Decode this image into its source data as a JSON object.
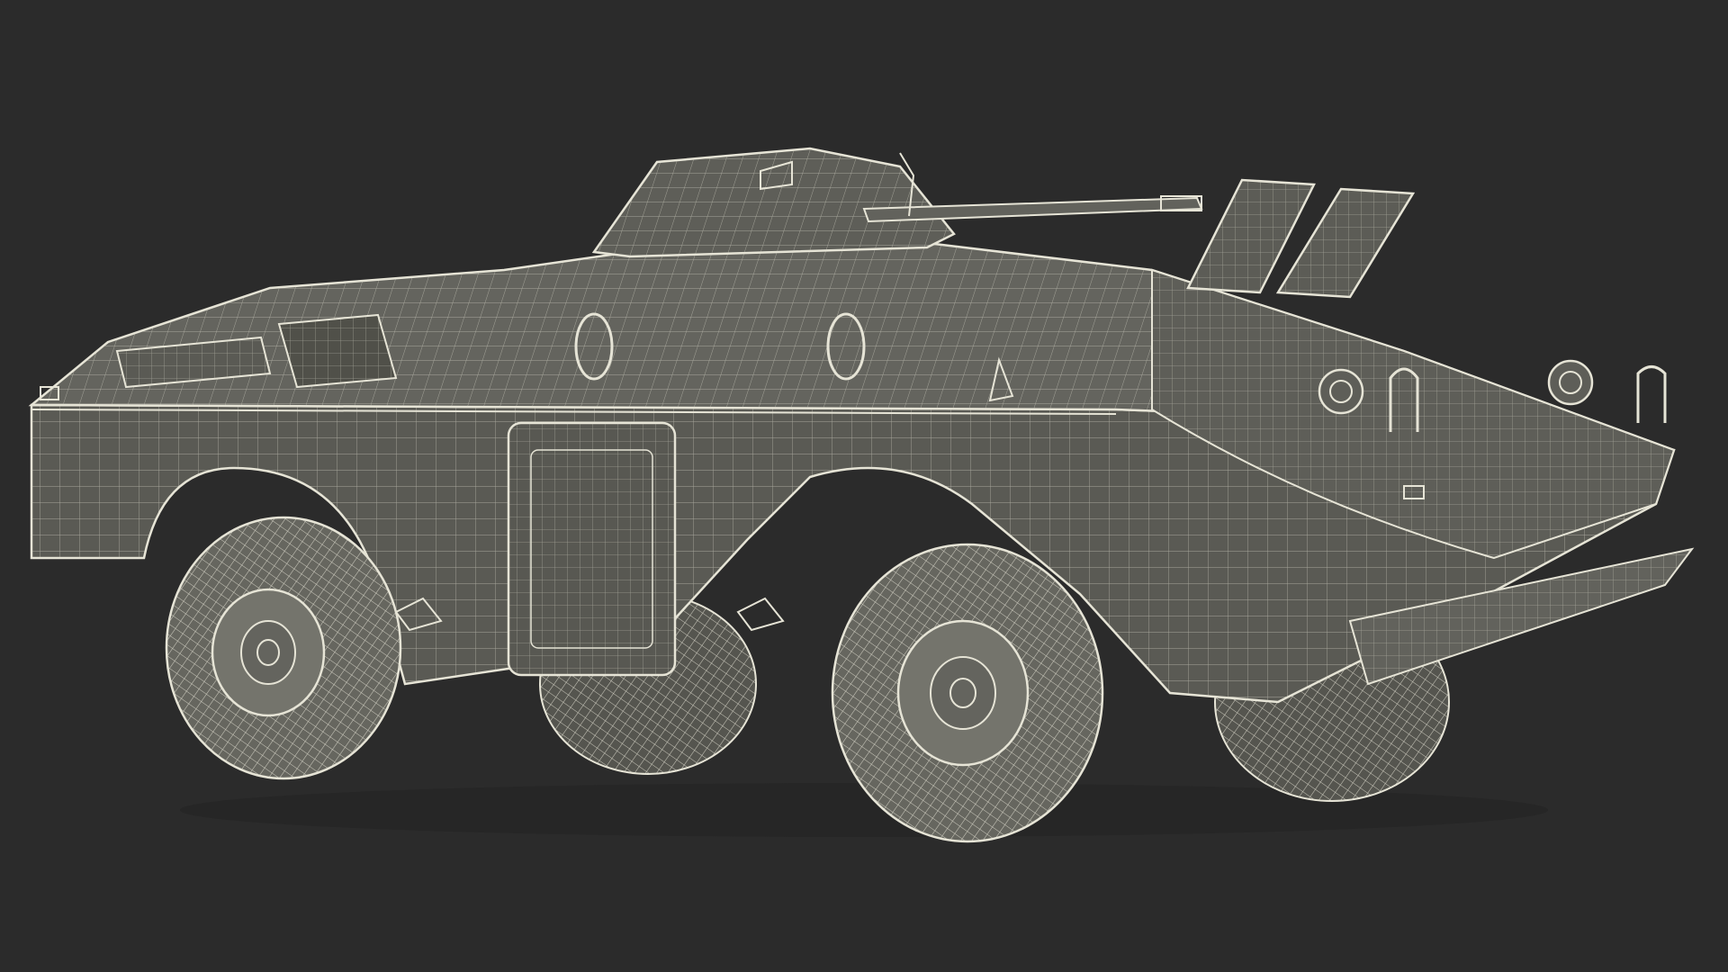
{
  "scene": {
    "subject_icon": "armored-vehicle-wireframe-icon",
    "colors": {
      "background": "#2b2b2b",
      "wire": "#e6e4d6",
      "wire_dim": "#9c9a8e",
      "body_fill": "#5c5c56",
      "body_fill_dark": "#474743",
      "tire_fill": "#6a6a64",
      "hub_fill": "#7a7a72"
    }
  }
}
